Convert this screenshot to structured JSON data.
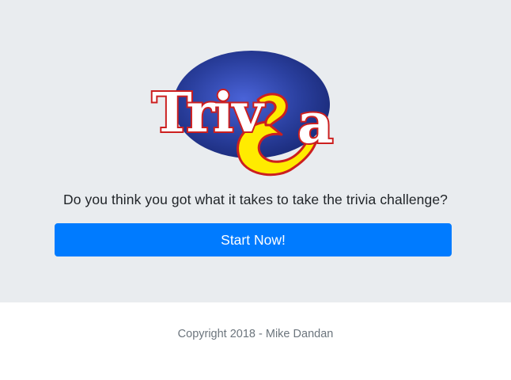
{
  "logo": {
    "letters": "Triv",
    "letters_2": "a",
    "accent_glyph": "i",
    "question_glyph": "¿",
    "oval_color": "#2a3f9e",
    "letter_fill": "#ffffff",
    "letter_outline": "#cc1f1f",
    "accent_fill": "#ffeb00"
  },
  "hero": {
    "tagline": "Do you think you got what it takes to take the trivia challenge?",
    "start_label": "Start Now!"
  },
  "footer": {
    "copyright": "Copyright 2018 - Mike Dandan"
  },
  "colors": {
    "jumbotron_bg": "#e9ecef",
    "primary": "#007bff",
    "text": "#212529",
    "muted": "#6c757d"
  }
}
